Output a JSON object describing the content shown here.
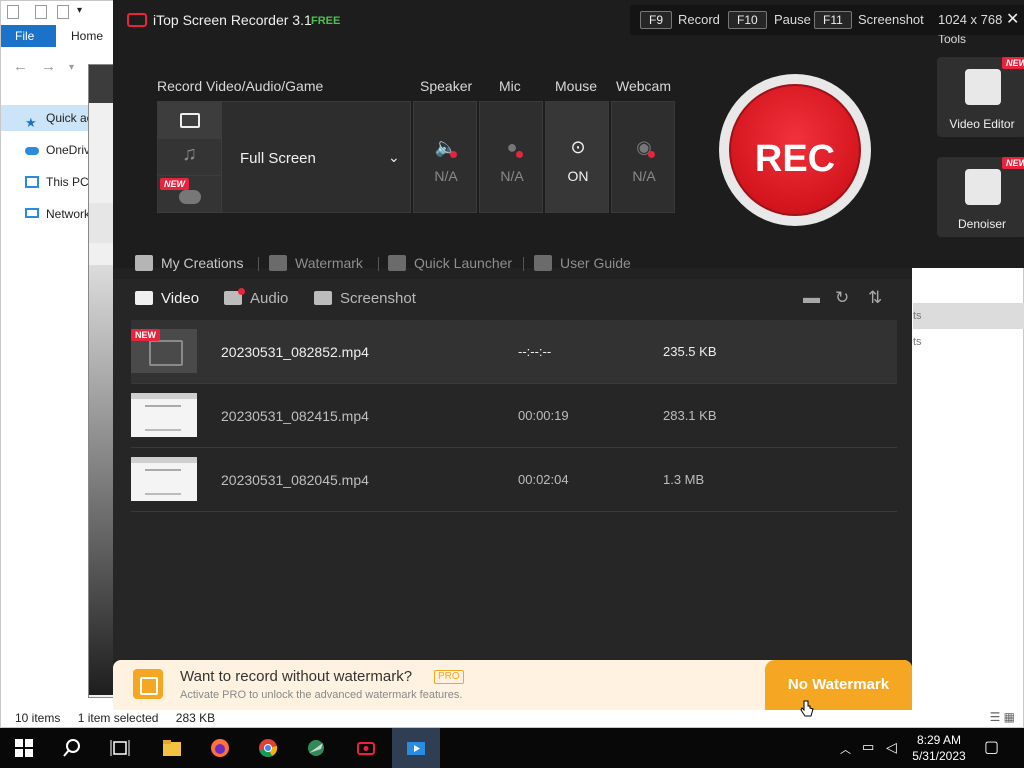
{
  "explorer": {
    "ribbon_tabs": [
      "File",
      "Home"
    ],
    "nav_items": [
      "Quick access",
      "OneDrive",
      "This PC",
      "Network"
    ],
    "status": {
      "items": "10 items",
      "selected": "1 item selected",
      "size": "283 KB"
    },
    "right_rows": [
      "ts",
      "ts"
    ]
  },
  "tools": {
    "label": "Tools",
    "cards": [
      {
        "label": "Video Editor",
        "badge": "NEW"
      },
      {
        "label": "Denoiser",
        "badge": "NEW"
      }
    ]
  },
  "app": {
    "title": "iTop Screen Recorder 3.1",
    "edition": "FREE",
    "hotkeys": [
      {
        "key": "F9",
        "label": "Record"
      },
      {
        "key": "F10",
        "label": "Pause"
      },
      {
        "key": "F11",
        "label": "Screenshot"
      }
    ],
    "resolution": "1024 x 768",
    "close": "✕",
    "sections": {
      "mode": "Record Video/Audio/Game",
      "speaker": "Speaker",
      "mic": "Mic",
      "mouse": "Mouse",
      "webcam": "Webcam"
    },
    "mode_badge": "NEW",
    "mode_value": "Full Screen",
    "devices": {
      "speaker": "N/A",
      "mic": "N/A",
      "mouse": "ON",
      "webcam": "N/A"
    },
    "rec_label": "REC",
    "links": [
      "My Creations",
      "Watermark",
      "Quick Launcher",
      "User Guide"
    ]
  },
  "files": {
    "tabs": [
      "Video",
      "Audio",
      "Screenshot"
    ],
    "active_tab": "Video",
    "rows": [
      {
        "badge": "NEW",
        "name": "20230531_082852.mp4",
        "duration": "--:--:--",
        "size": "235.5 KB",
        "selected": true
      },
      {
        "badge": "",
        "name": "20230531_082415.mp4",
        "duration": "00:00:19",
        "size": "283.1 KB",
        "selected": false
      },
      {
        "badge": "",
        "name": "20230531_082045.mp4",
        "duration": "00:02:04",
        "size": "1.3 MB",
        "selected": false
      }
    ]
  },
  "banner": {
    "title": "Want to record without watermark?",
    "pro_tag": "PRO",
    "subtitle": "Activate PRO to unlock the advanced watermark features.",
    "button": "No Watermark"
  },
  "taskbar": {
    "time": "8:29 AM",
    "date": "5/31/2023",
    "apps": [
      "start",
      "search",
      "task-view",
      "file-explorer",
      "firefox",
      "chrome",
      "app-green",
      "itop-recorder",
      "itop-active"
    ]
  },
  "colors": {
    "accent_red": "#e8243c",
    "accent_orange": "#f5a623",
    "free_green": "#4fc14f"
  }
}
